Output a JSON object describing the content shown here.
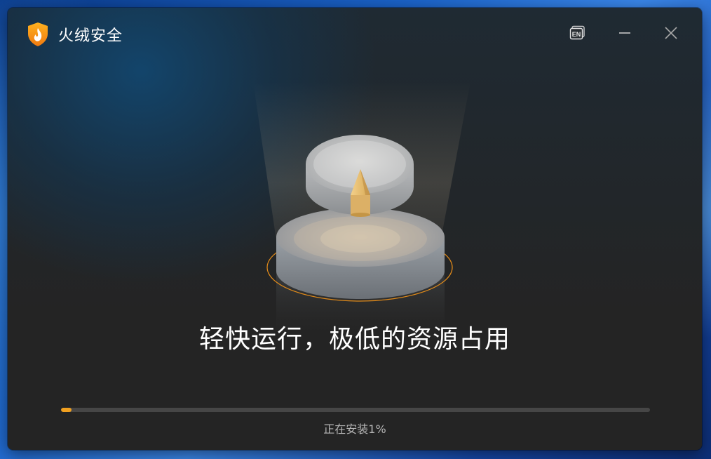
{
  "window": {
    "title": "火绒安全",
    "lang_button": "EN"
  },
  "icons": {
    "logo": "huorong-shield-flame-icon",
    "lang": "language-en-icon",
    "minimize": "minimize-icon",
    "close": "close-icon"
  },
  "main": {
    "slogan": "轻快运行，极低的资源占用"
  },
  "progress": {
    "percent": 1,
    "text": "正在安装1%"
  },
  "colors": {
    "accent": "#f0a020",
    "window_bg": "#232323"
  }
}
